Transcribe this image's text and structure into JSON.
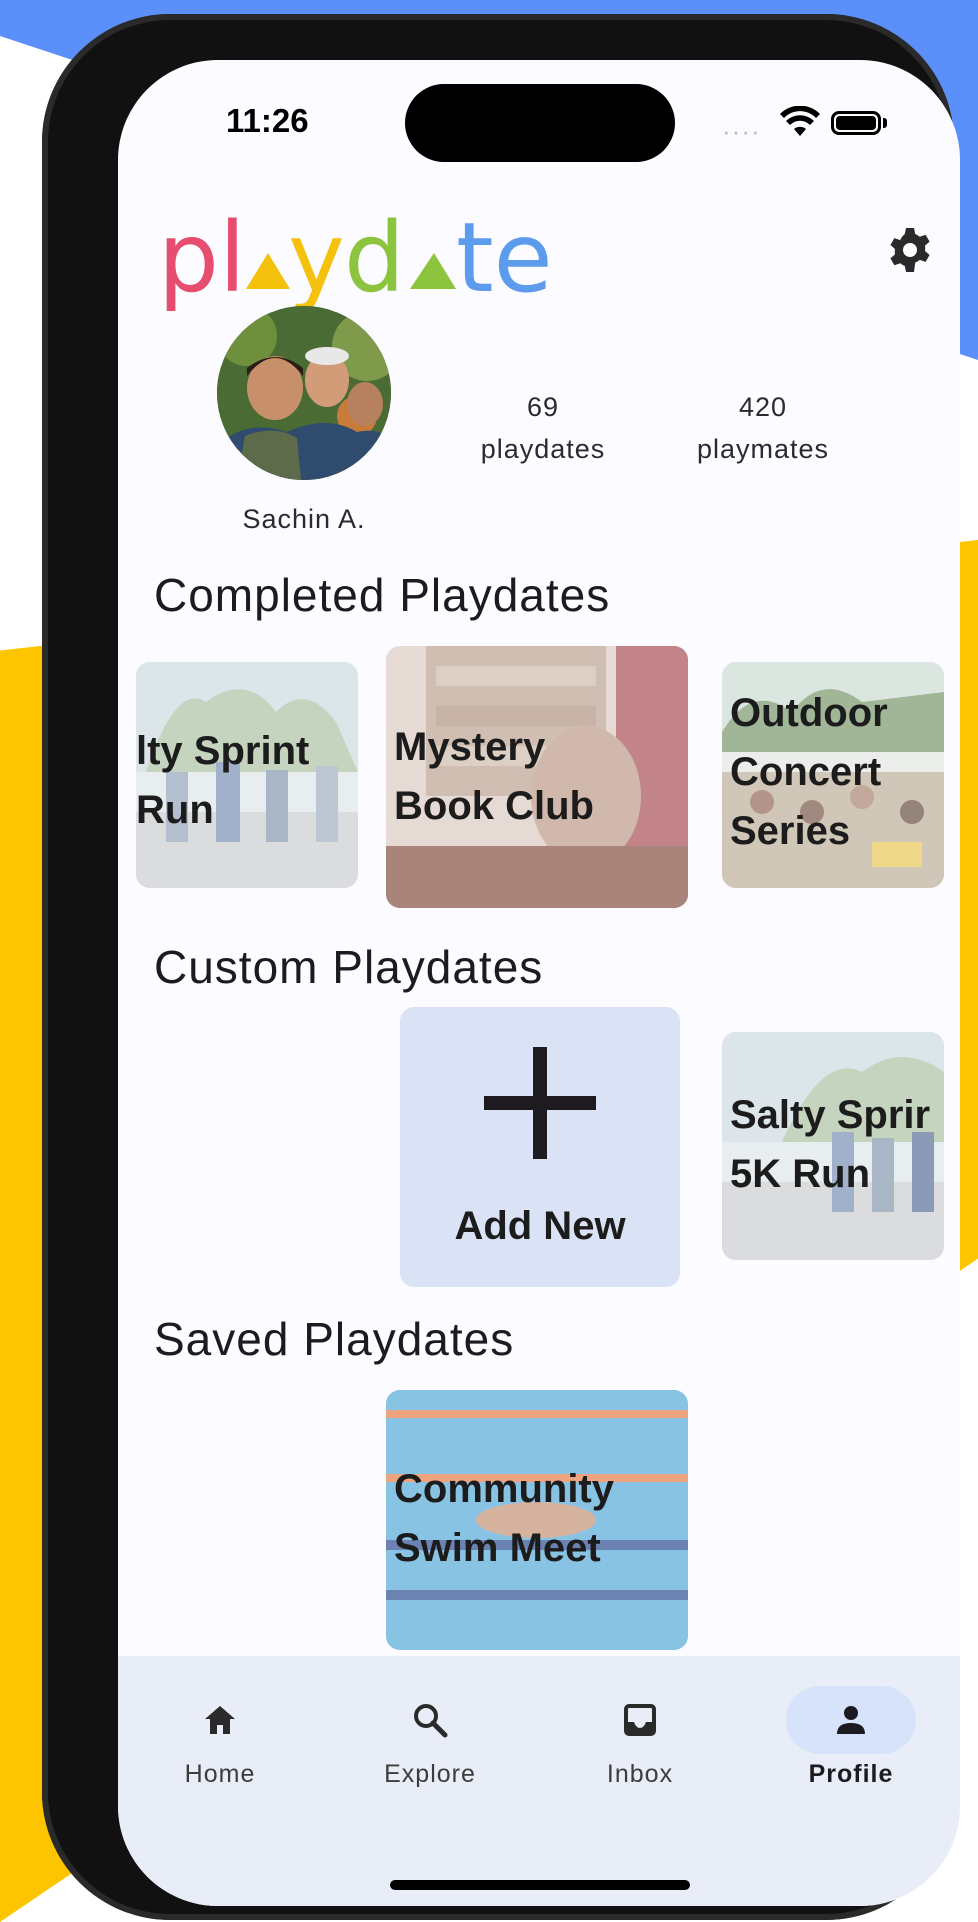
{
  "status_bar": {
    "time": "11:26",
    "signal_dots": "····"
  },
  "header": {
    "logo_letters": [
      "p",
      "l",
      "▲",
      "y",
      "d",
      "▲",
      "t",
      "e"
    ],
    "logo_colors": [
      "#e64d6e",
      "#e64d6e",
      "#f4c20d",
      "#f4c20d",
      "#8cc43f",
      "#8cc43f",
      "#5d9cec",
      "#5d9cec"
    ]
  },
  "profile": {
    "name": "Sachin A.",
    "playdates_count": "69",
    "playdates_label": "playdates",
    "playmates_count": "420",
    "playmates_label": "playmates"
  },
  "sections": {
    "completed_title": "Completed Playdates",
    "custom_title": "Custom Playdates",
    "saved_title": "Saved Playdates"
  },
  "completed_cards": [
    {
      "line1": "lty Sprint",
      "line2": "Run"
    },
    {
      "line1": "Mystery",
      "line2": "Book Club"
    },
    {
      "line1": "Outdoor",
      "line2": "Concert",
      "line3": "Series"
    }
  ],
  "custom": {
    "add_label": "Add New",
    "card": {
      "line1": "Salty Sprir",
      "line2": "5K Run"
    }
  },
  "saved_cards": [
    {
      "line1": "Community",
      "line2": "Swim Meet"
    }
  ],
  "nav": {
    "items": [
      {
        "label": "Home",
        "icon": "home-icon"
      },
      {
        "label": "Explore",
        "icon": "search-icon"
      },
      {
        "label": "Inbox",
        "icon": "inbox-icon"
      },
      {
        "label": "Profile",
        "icon": "person-icon"
      }
    ],
    "active": "Profile"
  },
  "colors": {
    "accent_blue": "#5b8ff9",
    "accent_yellow": "#fdc500",
    "nav_bg": "#e8edf7"
  }
}
